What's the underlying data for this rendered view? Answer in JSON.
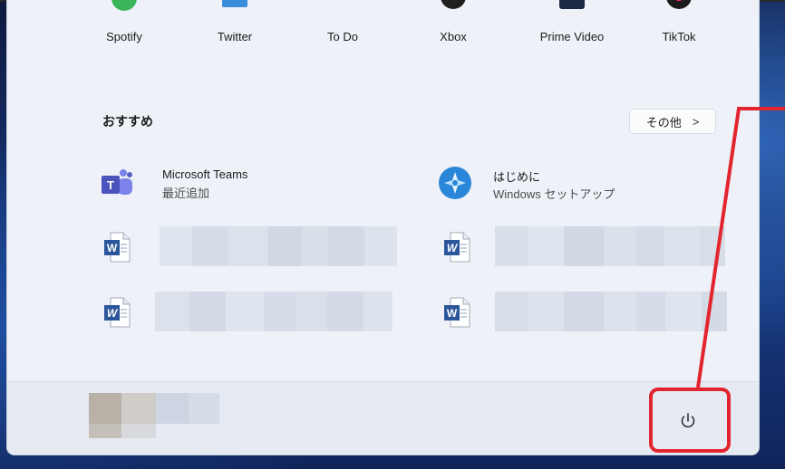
{
  "pinned_apps": [
    {
      "label": "Spotify",
      "icon": "spotify-icon",
      "color": "#3cb55a"
    },
    {
      "label": "Twitter",
      "icon": "twitter-icon",
      "color": "#3a8ddb"
    },
    {
      "label": "To Do",
      "icon": "todo-icon",
      "color": "#3a6fd6"
    },
    {
      "label": "Xbox",
      "icon": "xbox-icon",
      "color": "#1f1f1f"
    },
    {
      "label": "Prime Video",
      "icon": "prime-video-icon",
      "color": "#1a2a45"
    },
    {
      "label": "TikTok",
      "icon": "tiktok-icon",
      "color": "#1b1b1b"
    }
  ],
  "recommended": {
    "title": "おすすめ",
    "more_label": "その他",
    "more_chevron": ">",
    "items": [
      {
        "title": "Microsoft Teams",
        "subtitle": "最近追加",
        "icon": "teams-icon"
      },
      {
        "title": "はじめに",
        "subtitle": "Windows セットアップ",
        "icon": "get-started-icon"
      }
    ]
  },
  "colors": {
    "accent_red": "#e3252f",
    "word_blue": "#2b579a",
    "teams_purple": "#5b5fc7",
    "menu_bg": "#eef2f8"
  }
}
